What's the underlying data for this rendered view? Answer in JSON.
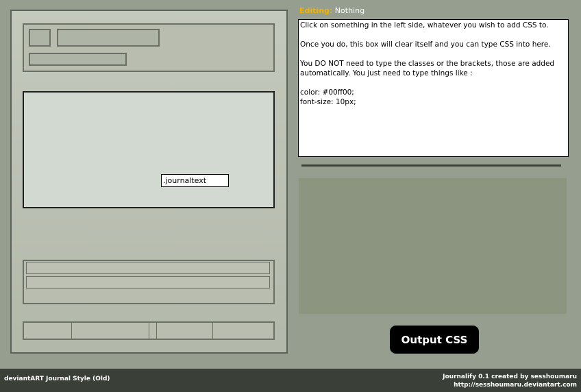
{
  "preview": {
    "journaltext_label": ".journaltext"
  },
  "editor": {
    "editing_label": "Editing:",
    "editing_value": "Nothing",
    "instructions": "Click on something in the left side, whatever you wish to add CSS to.\n\nOnce you do, this box will clear itself and you can type CSS into here.\n\nYou DO NOT need to type the classes or the brackets, those are added automatically. You just need to type things like :\n\ncolor: #00ff00;\nfont-size: 10px;"
  },
  "output_button": "Output CSS",
  "footer": {
    "left": "deviantART Journal Style (Old)",
    "credit": "Journalify 0.1 created by sesshoumaru",
    "url": "http://sesshoumaru.deviantart.com"
  },
  "colors": {
    "background": "#969e90",
    "footer": "#3a3f38",
    "editing_label": "#f0b300",
    "button": "#000000"
  }
}
